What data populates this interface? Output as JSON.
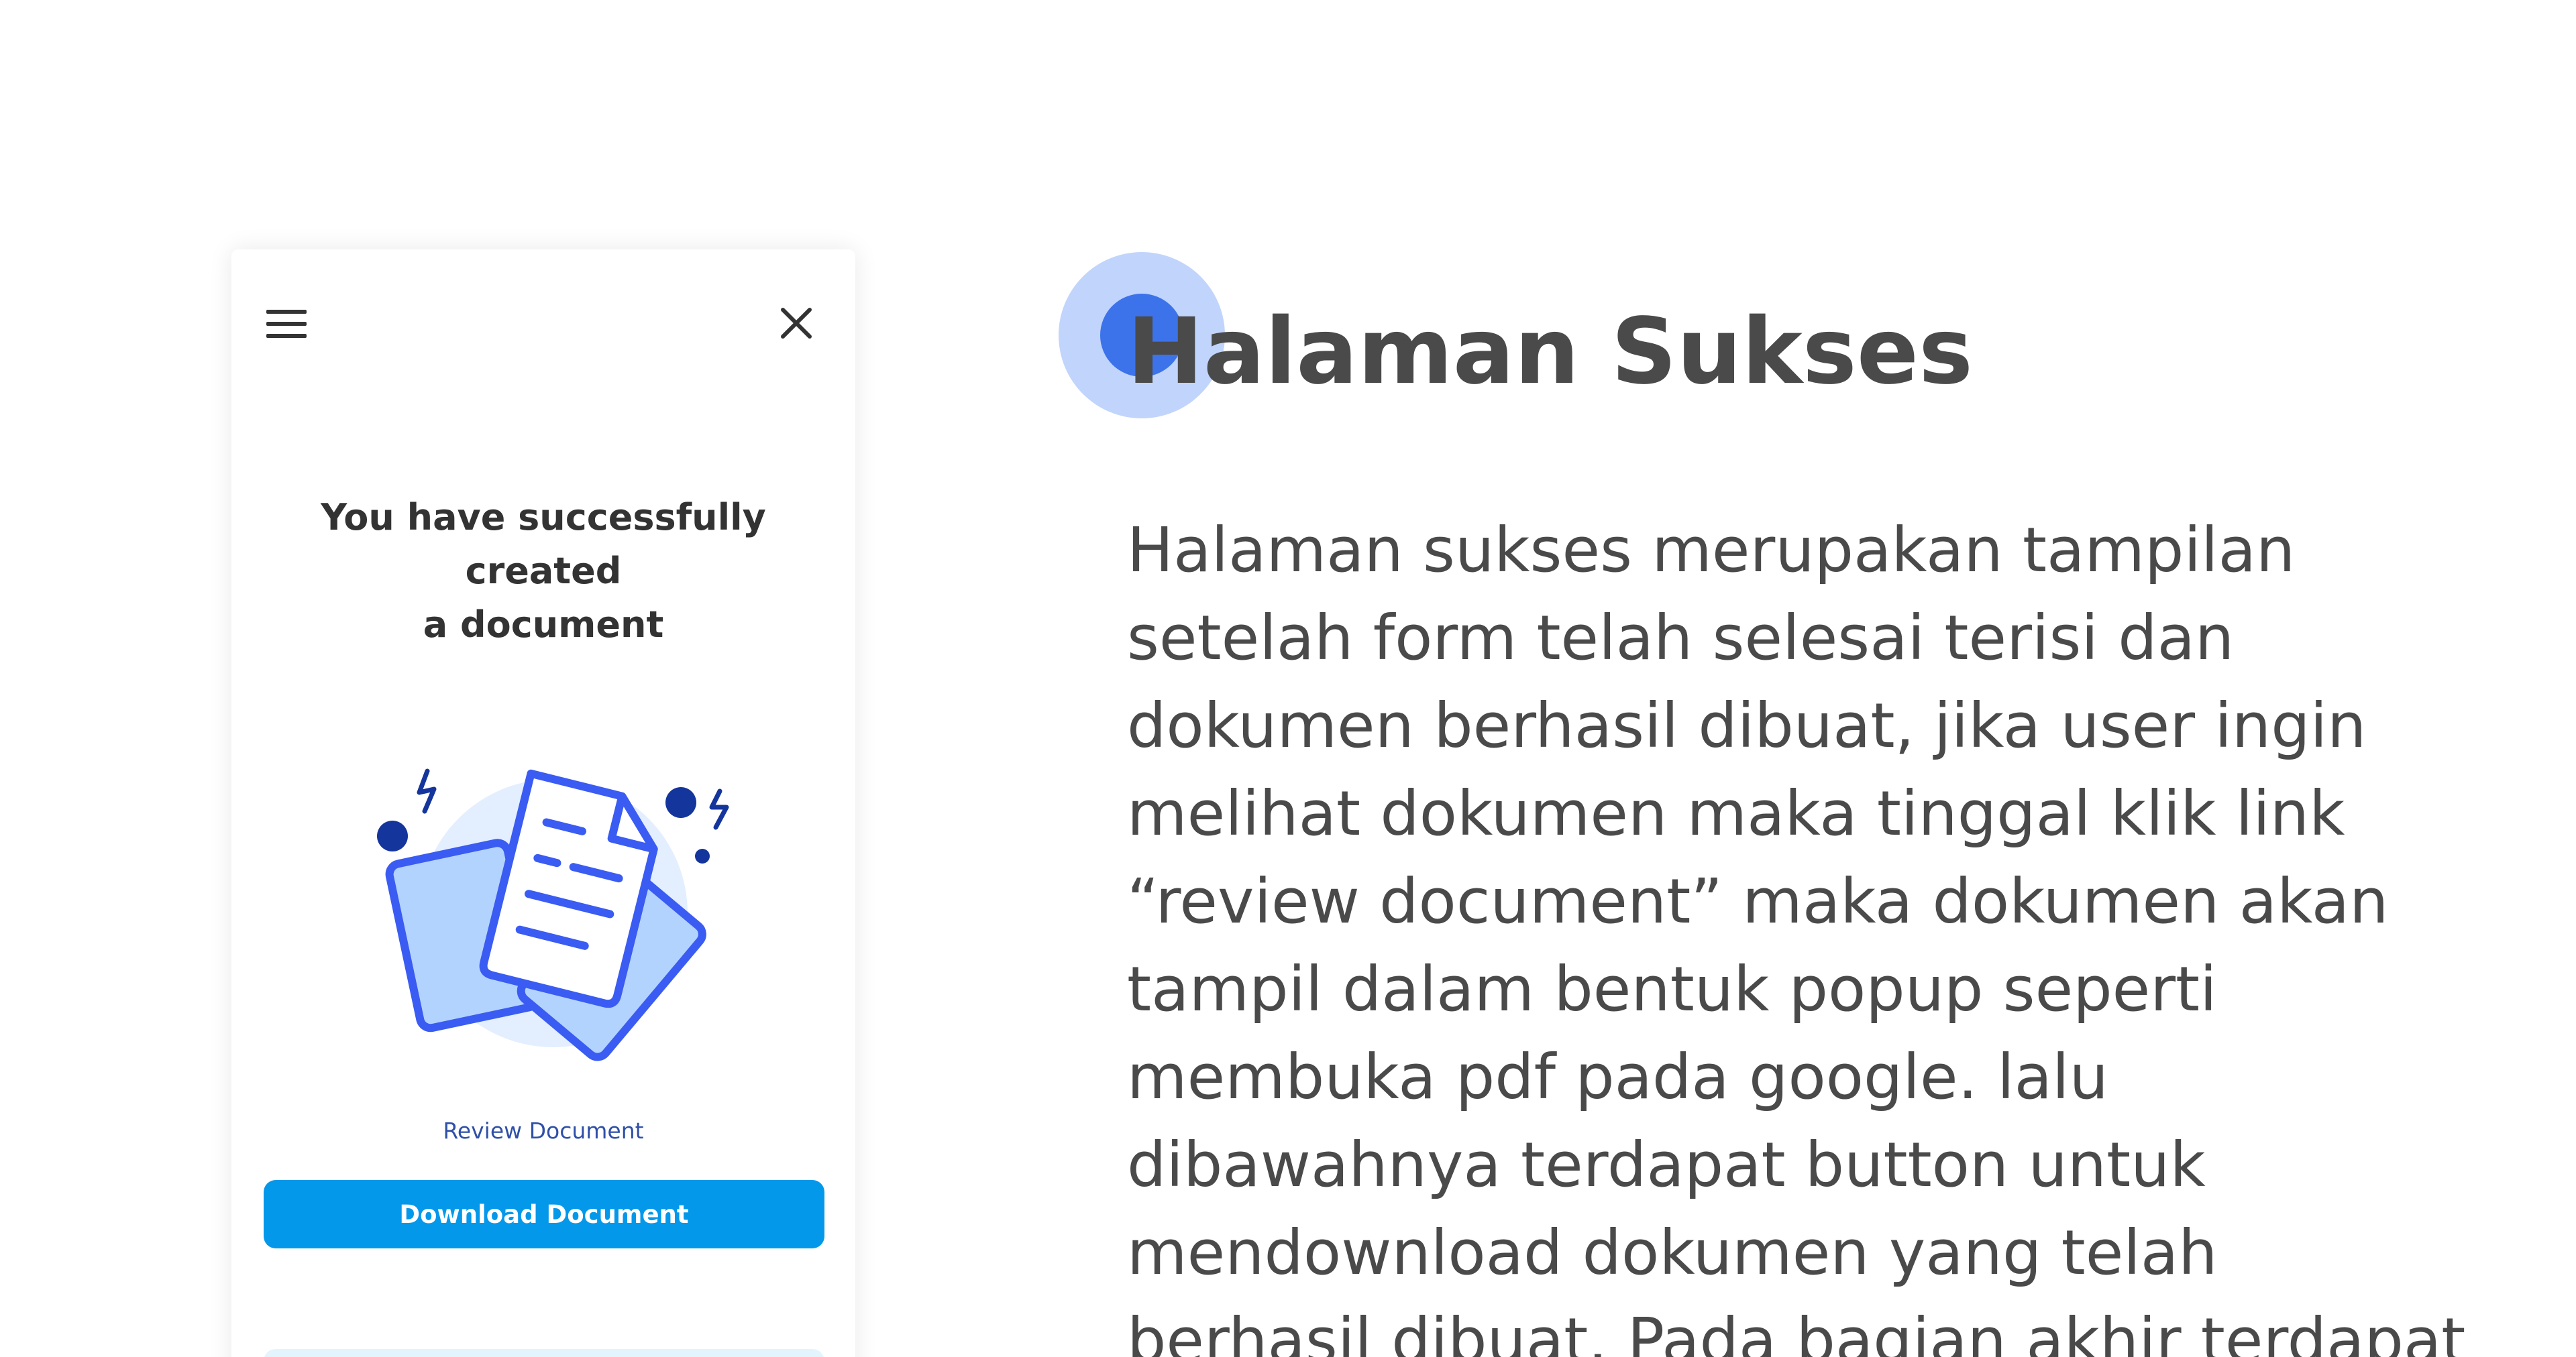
{
  "phone": {
    "success_message_line1": "You have successfully created",
    "success_message_line2": "a document",
    "review_link": "Review Document",
    "download_button": "Download Document",
    "icons": {
      "menu": "hamburger-menu-icon",
      "close": "close-icon",
      "illustration": "documents-illustration"
    }
  },
  "content": {
    "title": "Halaman Sukses",
    "description_lines": [
      "Halaman sukses merupakan tampilan",
      "setelah form telah selesai terisi dan",
      "dokumen berhasil dibuat, jika user ingin",
      "melihat dokumen maka tinggal klik link",
      "“review document” maka dokumen akan",
      "tampil dalam bentuk popup seperti",
      "membuka pdf pada google. lalu",
      "dibawahnya terdapat button untuk",
      "mendownload dokumen yang telah",
      "berhasil dibuat. Pada bagian akhir terdapat"
    ]
  },
  "colors": {
    "accent": "#0498ea",
    "link": "#2f50a8",
    "step_marker": "#3c73ea",
    "heading_text": "#4a4a4a",
    "illustration_blue": "#3a5cf2",
    "illustration_dark": "#14359c"
  }
}
